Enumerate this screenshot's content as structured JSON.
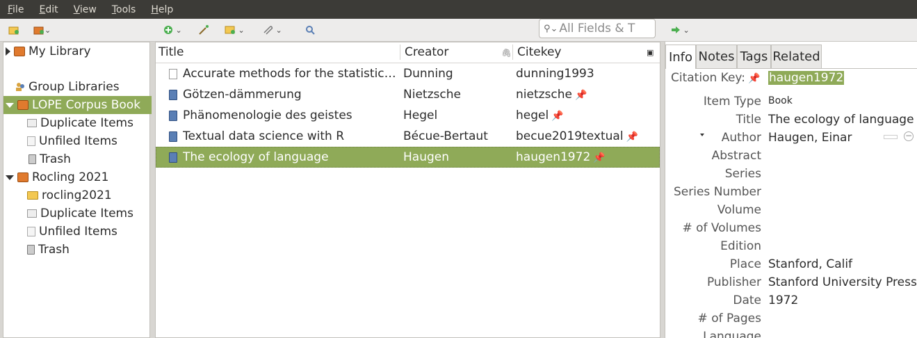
{
  "menu": [
    {
      "label": "File",
      "u": "F",
      "rest": "ile"
    },
    {
      "label": "Edit",
      "u": "E",
      "rest": "dit"
    },
    {
      "label": "View",
      "u": "V",
      "rest": "iew"
    },
    {
      "label": "Tools",
      "u": "T",
      "rest": "ools"
    },
    {
      "label": "Help",
      "u": "H",
      "rest": "elp"
    }
  ],
  "search": {
    "placeholder": "All Fields & T"
  },
  "tree": {
    "my_library": "My Library",
    "group_libraries": "Group Libraries",
    "lope": "LOPE Corpus Book",
    "lope_dup": "Duplicate Items",
    "lope_unfiled": "Unfiled Items",
    "lope_trash": "Trash",
    "rocling": "Rocling 2021",
    "rocling_folder": "rocling2021",
    "rocling_dup": "Duplicate Items",
    "rocling_unfiled": "Unfiled Items",
    "rocling_trash": "Trash"
  },
  "table": {
    "headers": {
      "title": "Title",
      "creator": "Creator",
      "citekey": "Citekey"
    },
    "rows": [
      {
        "title": "Accurate methods for the statistics of surprise and coincidence",
        "creator": "Dunning",
        "citekey": "dunning1993",
        "pinned": false,
        "type": "document"
      },
      {
        "title": "Götzen-dämmerung",
        "creator": "Nietzsche",
        "citekey": "nietzsche",
        "pinned": true,
        "type": "book"
      },
      {
        "title": "Phänomenologie des geistes",
        "creator": "Hegel",
        "citekey": "hegel",
        "pinned": true,
        "type": "book"
      },
      {
        "title": "Textual data science with R",
        "creator": "Bécue-Bertaut",
        "citekey": "becue2019textual",
        "pinned": true,
        "type": "book"
      },
      {
        "title": "The ecology of language",
        "creator": "Haugen",
        "citekey": "haugen1972",
        "pinned": true,
        "type": "book"
      }
    ]
  },
  "tabs": [
    "Info",
    "Notes",
    "Tags",
    "Related"
  ],
  "info": {
    "citation_key_label": "Citation Key:",
    "citation_key": "haugen1972",
    "fields": [
      {
        "label": "Item Type",
        "value": "Book"
      },
      {
        "label": "Title",
        "value": "The ecology of language"
      },
      {
        "label": "Author",
        "value": "Haugen, Einar"
      },
      {
        "label": "Abstract",
        "value": ""
      },
      {
        "label": "Series",
        "value": ""
      },
      {
        "label": "Series Number",
        "value": ""
      },
      {
        "label": "Volume",
        "value": ""
      },
      {
        "label": "# of Volumes",
        "value": ""
      },
      {
        "label": "Edition",
        "value": ""
      },
      {
        "label": "Place",
        "value": "Stanford, Calif"
      },
      {
        "label": "Publisher",
        "value": "Stanford University Press"
      },
      {
        "label": "Date",
        "value": "1972"
      },
      {
        "label": "# of Pages",
        "value": ""
      },
      {
        "label": "Language",
        "value": ""
      }
    ]
  }
}
